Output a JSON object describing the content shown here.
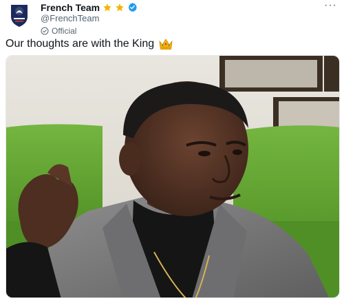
{
  "account": {
    "display_name": "French Team",
    "handle": "@FrenchTeam",
    "label": "Official",
    "avatar_icon": "fff-crest-icon",
    "badges": [
      "star-icon",
      "star-icon",
      "verified-badge-icon"
    ]
  },
  "tweet": {
    "text": "Our thoughts are with the King",
    "emoji_icon": "crown-emoji-icon",
    "more_label": "···"
  },
  "colors": {
    "text": "#0f1419",
    "secondary": "#536471",
    "verified_blue": "#1d9bf0",
    "star_gold": "#f4b400",
    "crest_navy": "#1b2a5c"
  }
}
